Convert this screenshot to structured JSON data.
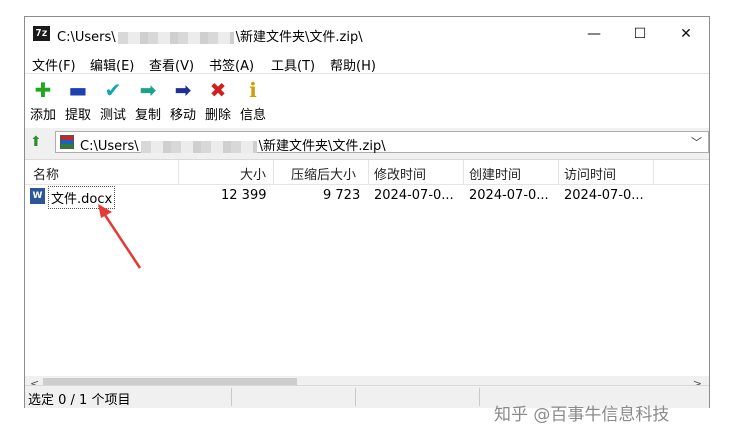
{
  "window": {
    "title_prefix": "C:\\Users\\",
    "title_suffix": "\\新建文件夹\\文件.zip\\",
    "app_icon_text": "7z",
    "controls": {
      "minimize": "—",
      "maximize": "☐",
      "close": "✕"
    }
  },
  "menu": [
    "文件(F)",
    "编辑(E)",
    "查看(V)",
    "书签(A)",
    "工具(T)",
    "帮助(H)"
  ],
  "toolbar": [
    {
      "label": "添加",
      "icon": "plus-icon",
      "glyph": "✚",
      "color": "#1fa81f"
    },
    {
      "label": "提取",
      "icon": "minus-icon",
      "glyph": "▬",
      "color": "#1e3fb0"
    },
    {
      "label": "测试",
      "icon": "check-icon",
      "glyph": "✔",
      "color": "#11a6b5"
    },
    {
      "label": "复制",
      "icon": "copy-arrow-icon",
      "glyph": "➡",
      "color": "#1aa38a"
    },
    {
      "label": "移动",
      "icon": "move-arrow-icon",
      "glyph": "➡",
      "color": "#1e2f9a"
    },
    {
      "label": "删除",
      "icon": "delete-icon",
      "glyph": "✖",
      "color": "#d11f1f"
    },
    {
      "label": "信息",
      "icon": "info-icon",
      "glyph": "ℹ",
      "color": "#c9a100"
    }
  ],
  "address": {
    "prefix": "C:\\Users\\",
    "suffix": "\\新建文件夹\\文件.zip\\",
    "dropdown": "﹀"
  },
  "columns": [
    "名称",
    "大小",
    "压缩后大小",
    "修改时间",
    "创建时间",
    "访问时间"
  ],
  "rows": [
    {
      "name": "文件.docx",
      "icon_text": "W",
      "size": "12 399",
      "packed": "9 723",
      "modified": "2024-07-0...",
      "created": "2024-07-0...",
      "accessed": "2024-07-0..."
    }
  ],
  "scroll": {
    "left": "<",
    "right": ">"
  },
  "status": {
    "selection": "选定 0 / 1 个项目"
  },
  "watermark": "知乎 @百事牛信息科技",
  "colors": {
    "annotation_arrow": "#e53935",
    "word_blue": "#2b579a"
  }
}
